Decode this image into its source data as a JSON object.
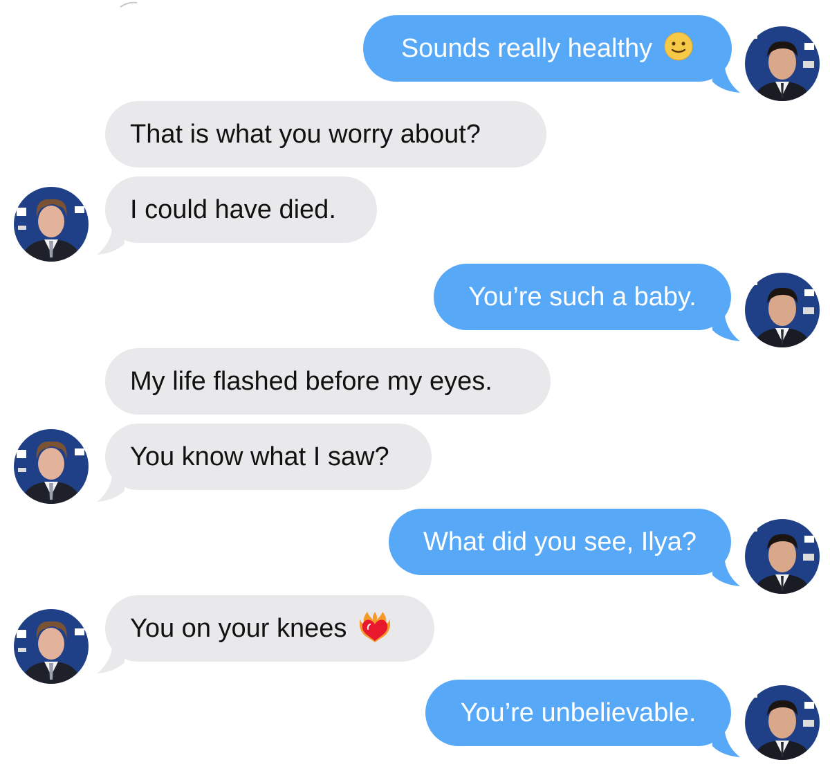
{
  "conversation": {
    "messages": [
      {
        "from": "me",
        "text": "Sounds really healthy",
        "emoji": "slightly-smiling-face"
      },
      {
        "from": "them",
        "text": "That is what you worry about?"
      },
      {
        "from": "them",
        "text": "I could have died."
      },
      {
        "from": "me",
        "text": "You’re such a baby."
      },
      {
        "from": "them",
        "text": "My life flashed before my eyes."
      },
      {
        "from": "them",
        "text": "You know what I saw?"
      },
      {
        "from": "me",
        "text": "What did you see, Ilya?"
      },
      {
        "from": "them",
        "text": "You on your knees",
        "emoji": "heart-on-fire"
      },
      {
        "from": "me",
        "text": "You’re unbelievable."
      }
    ]
  },
  "colors": {
    "sent_bubble": "#57a9f8",
    "received_bubble": "#e9e9eb",
    "sent_text": "#ffffff",
    "received_text": "#111111",
    "avatar_backdrop": "#1f3f86"
  },
  "icons": {
    "sender_avatar": "avatar-man-dark-hair",
    "receiver_avatar": "avatar-man-curly-hair"
  }
}
